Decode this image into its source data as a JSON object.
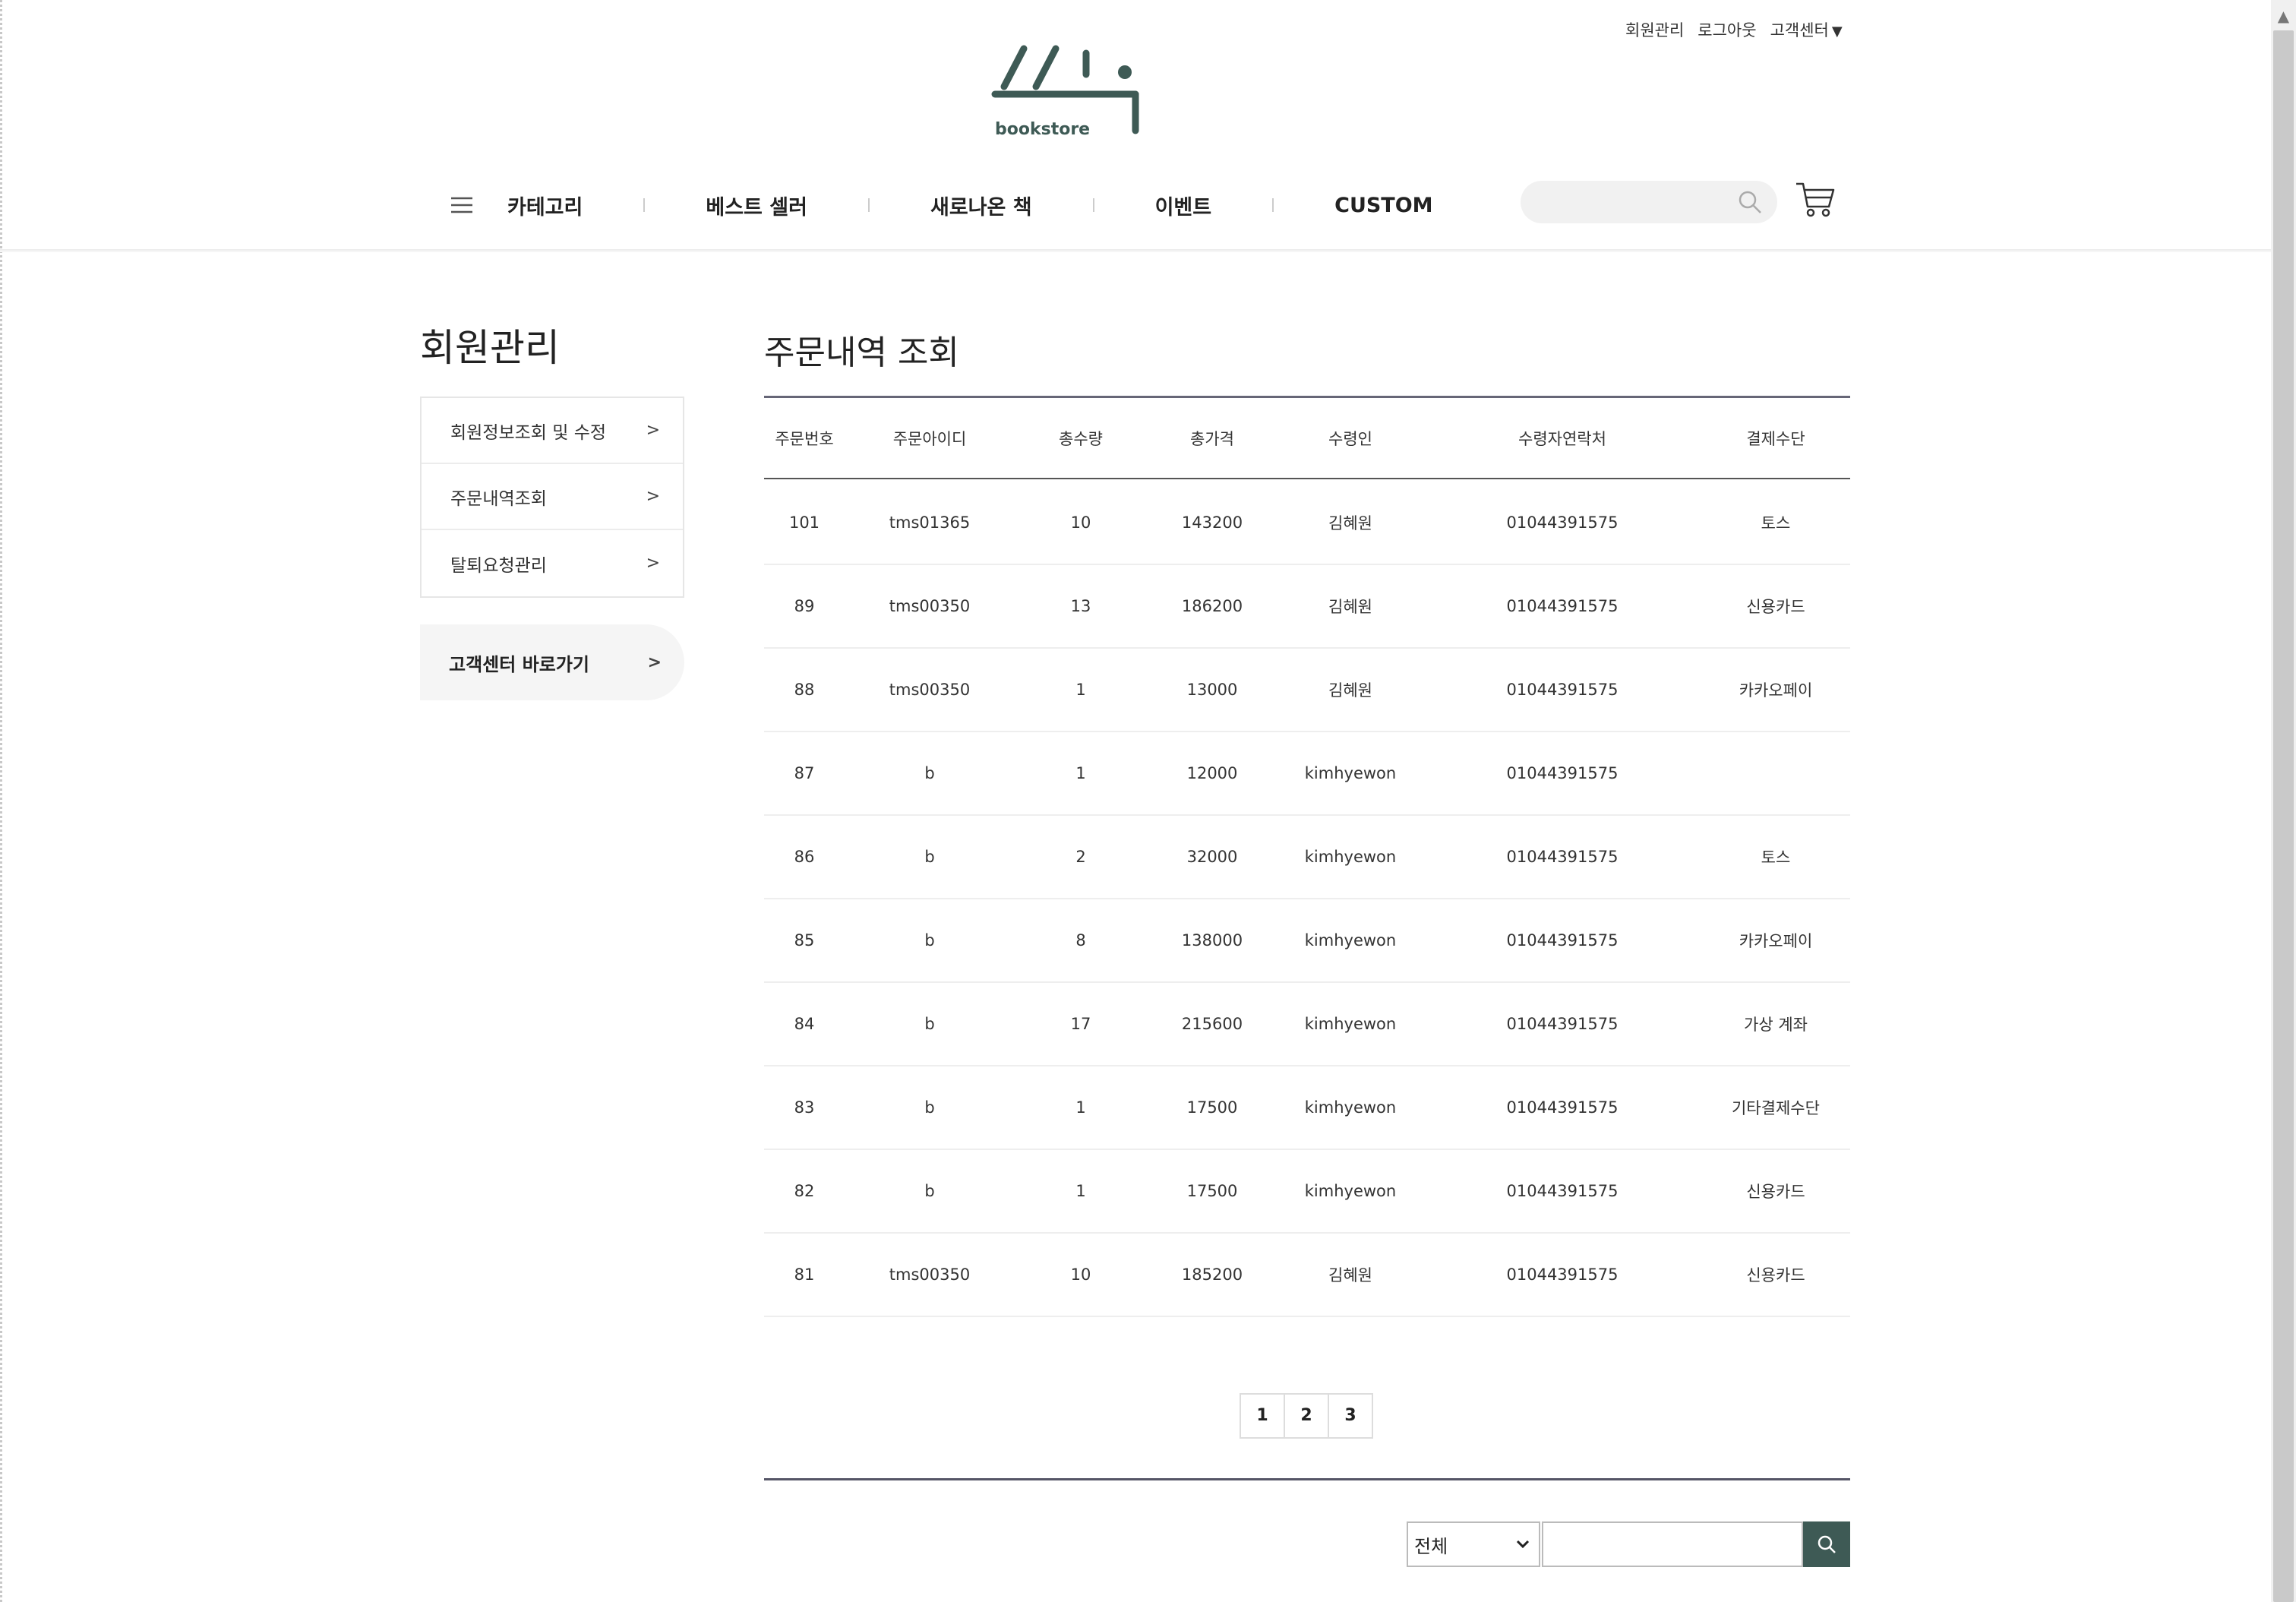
{
  "header": {
    "util_links": [
      "회원관리",
      "로그아웃",
      "고객센터"
    ],
    "dropdown_caret": "▼",
    "logo_text": "bookstore",
    "nav": [
      "카테고리",
      "베스트 셀러",
      "새로나온 책",
      "이벤트",
      "CUSTOM"
    ],
    "search_placeholder": ""
  },
  "sidebar": {
    "title": "회원관리",
    "items": [
      {
        "label": "회원정보조회 및 수정",
        "arrow": ">"
      },
      {
        "label": "주문내역조회",
        "arrow": ">"
      },
      {
        "label": "탈퇴요청관리",
        "arrow": ">"
      }
    ],
    "cs_link": {
      "label": "고객센터 바로가기",
      "arrow": ">"
    }
  },
  "main": {
    "title": "주문내역 조회",
    "columns": [
      "주문번호",
      "주문아이디",
      "총수량",
      "총가격",
      "수령인",
      "수령자연락처",
      "결제수단"
    ],
    "rows": [
      [
        "101",
        "tms01365",
        "10",
        "143200",
        "김혜원",
        "01044391575",
        "토스"
      ],
      [
        "89",
        "tms00350",
        "13",
        "186200",
        "김혜원",
        "01044391575",
        "신용카드"
      ],
      [
        "88",
        "tms00350",
        "1",
        "13000",
        "김혜원",
        "01044391575",
        "카카오페이"
      ],
      [
        "87",
        "b",
        "1",
        "12000",
        "kimhyewon",
        "01044391575",
        ""
      ],
      [
        "86",
        "b",
        "2",
        "32000",
        "kimhyewon",
        "01044391575",
        "토스"
      ],
      [
        "85",
        "b",
        "8",
        "138000",
        "kimhyewon",
        "01044391575",
        "카카오페이"
      ],
      [
        "84",
        "b",
        "17",
        "215600",
        "kimhyewon",
        "01044391575",
        "가상 계좌"
      ],
      [
        "83",
        "b",
        "1",
        "17500",
        "kimhyewon",
        "01044391575",
        "기타결제수단"
      ],
      [
        "82",
        "b",
        "1",
        "17500",
        "kimhyewon",
        "01044391575",
        "신용카드"
      ],
      [
        "81",
        "tms00350",
        "10",
        "185200",
        "김혜원",
        "01044391575",
        "신용카드"
      ]
    ],
    "pages": [
      "1",
      "2",
      "3"
    ],
    "filter": {
      "selected": "전체",
      "input_value": ""
    }
  },
  "colors": {
    "brand": "#3e5a55",
    "scroll_thumb": "#c9c9c9"
  }
}
